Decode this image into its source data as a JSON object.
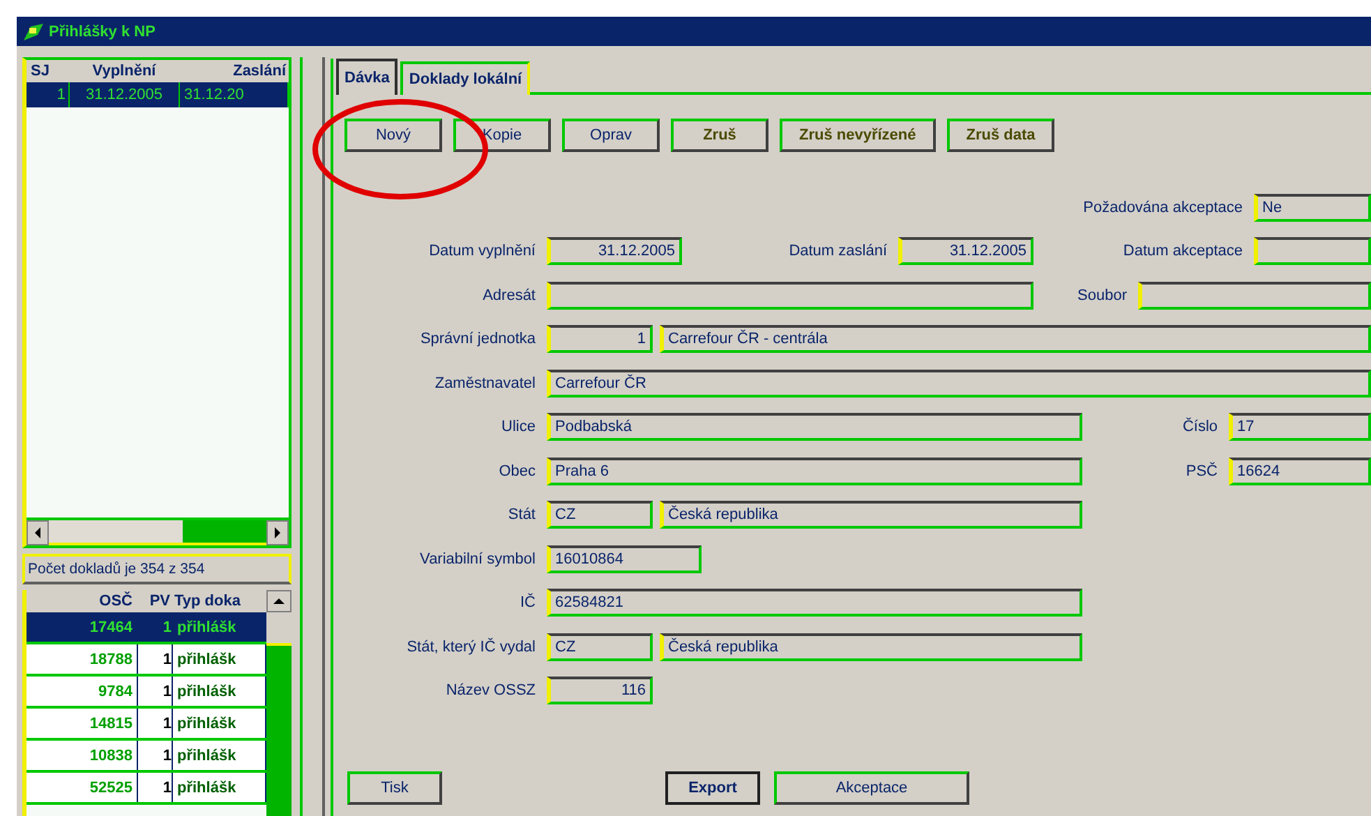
{
  "window": {
    "title": "Přihlášky k NP"
  },
  "batches": {
    "columns": [
      "SJ",
      "Vyplnění",
      "Zaslání"
    ],
    "rows": [
      {
        "cells": [
          "1",
          "31.12.2005",
          "31.12.20"
        ],
        "selected": true
      }
    ]
  },
  "count_text": "Počet dokladů je 354 z 354",
  "documents": {
    "columns": [
      "OSČ",
      "PV",
      "Typ doka"
    ],
    "rows": [
      {
        "cells": [
          "17464",
          "1",
          "přihlášk"
        ],
        "selected": true
      },
      {
        "cells": [
          "18788",
          "1",
          "přihlášk"
        ],
        "selected": false
      },
      {
        "cells": [
          "9784",
          "1",
          "přihlášk"
        ],
        "selected": false
      },
      {
        "cells": [
          "14815",
          "1",
          "přihlášk"
        ],
        "selected": false
      },
      {
        "cells": [
          "10838",
          "1",
          "přihlášk"
        ],
        "selected": false
      },
      {
        "cells": [
          "52525",
          "1",
          "přihlášk"
        ],
        "selected": false
      }
    ]
  },
  "tabs": [
    {
      "label": "Dávka",
      "selected": true
    },
    {
      "label": "Doklady lokální",
      "selected": false
    }
  ],
  "toolbar": [
    {
      "label": "Nový",
      "disabled": false
    },
    {
      "label": "Kopie",
      "disabled": false
    },
    {
      "label": "Oprav",
      "disabled": false
    },
    {
      "label": "Zruš",
      "disabled": true
    },
    {
      "label": "Zruš nevyřízené",
      "disabled": true
    },
    {
      "label": "Zruš data",
      "disabled": true
    }
  ],
  "form": [
    {
      "items": [
        {
          "label": "Požadována akceptace",
          "values": [
            "Ne"
          ]
        }
      ]
    },
    {
      "items": [
        {
          "label": "Datum vyplnění",
          "values": [
            "31.12.2005"
          ]
        },
        {
          "label": "Datum zaslání",
          "values": [
            "31.12.2005"
          ]
        },
        {
          "label": "Datum akceptace"
        }
      ]
    },
    {
      "items": [
        {
          "label": "Adresát"
        },
        {
          "label": "Soubor"
        }
      ]
    },
    {
      "items": [
        {
          "label": "Správní jednotka",
          "values": [
            "1",
            "Carrefour ČR - centrála"
          ]
        }
      ]
    },
    {
      "items": [
        {
          "label": "Zaměstnavatel",
          "values": [
            "Carrefour ČR"
          ]
        }
      ]
    },
    {
      "items": [
        {
          "label": "Ulice",
          "values": [
            "Podbabská"
          ]
        },
        {
          "label": "Číslo",
          "values": [
            "17"
          ]
        }
      ]
    },
    {
      "items": [
        {
          "label": "Obec",
          "values": [
            "Praha 6"
          ]
        },
        {
          "label": "PSČ",
          "values": [
            "16624"
          ]
        }
      ]
    },
    {
      "items": [
        {
          "label": "Stát",
          "values": [
            "CZ",
            "Česká republika"
          ]
        }
      ]
    },
    {
      "items": [
        {
          "label": "Variabilní symbol",
          "values": [
            "16010864"
          ]
        }
      ]
    },
    {
      "items": [
        {
          "label": "IČ",
          "values": [
            "62584821"
          ]
        }
      ]
    },
    {
      "items": [
        {
          "label": "Stát, který IČ vydal",
          "values": [
            "CZ",
            "Česká republika"
          ]
        }
      ]
    },
    {
      "items": [
        {
          "label": "Název OSSZ",
          "values": [
            "116"
          ]
        }
      ]
    }
  ],
  "bottom_buttons": [
    {
      "label": "Tisk",
      "default": false
    },
    {
      "label": "Export",
      "default": true
    },
    {
      "label": "Akceptace",
      "default": false
    }
  ]
}
